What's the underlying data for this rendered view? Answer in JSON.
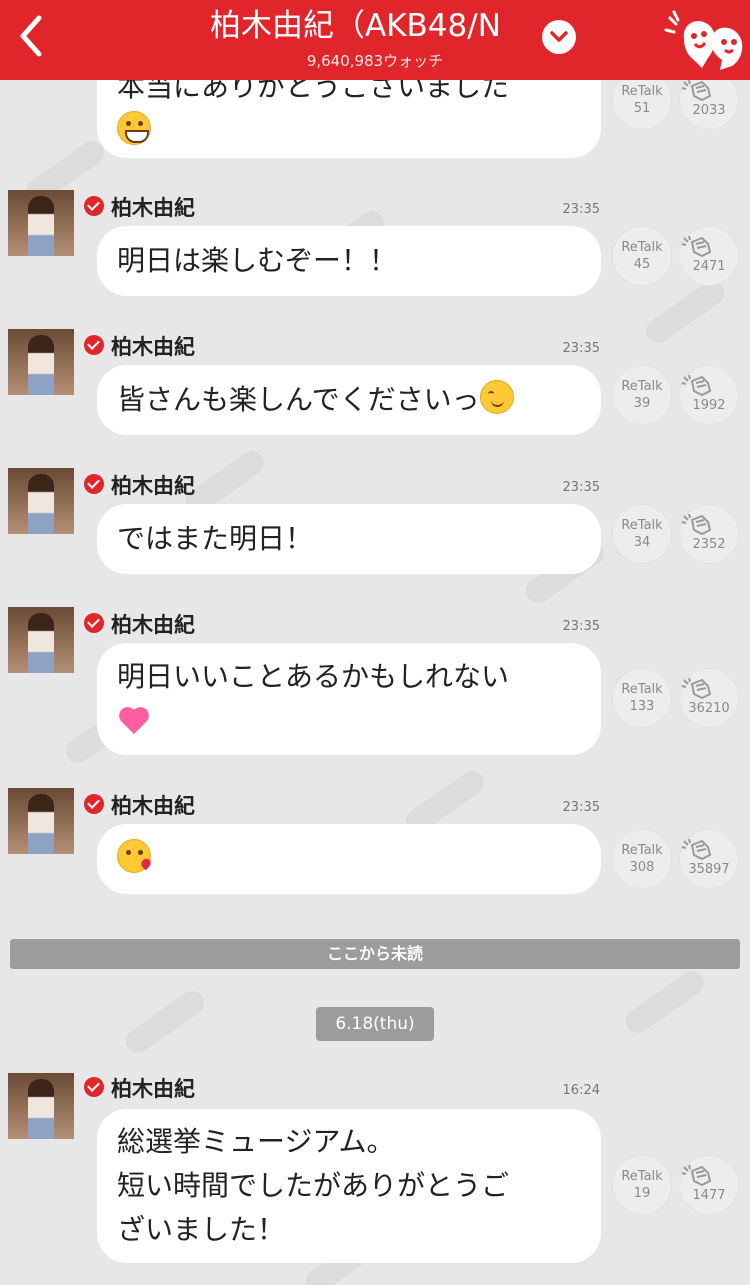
{
  "header": {
    "title": "柏木由紀（AKB48/N",
    "watchers": "9,640,983ウォッチ"
  },
  "colors": {
    "brand_red": "#e0262b",
    "bubble_bg": "#ffffff",
    "page_bg": "#e7e7e7"
  },
  "icons": {
    "back": "chevron-left-icon",
    "dropdown": "chevron-down-icon",
    "mascot": "mascot-icon",
    "verified": "verified-check-icon",
    "clap": "clap-icon"
  },
  "retalk_label": "ReTalk",
  "messages": [
    {
      "id": "m0",
      "partial": true,
      "lines": [
        "本当にありがとうございました"
      ],
      "emoji": "grin",
      "retalk": "51",
      "claps": "2033"
    },
    {
      "id": "m1",
      "author": "柏木由紀",
      "time": "23:35",
      "lines": [
        "明日は楽しむぞー！！"
      ],
      "retalk": "45",
      "claps": "2471"
    },
    {
      "id": "m2",
      "author": "柏木由紀",
      "time": "23:35",
      "lines": [
        "皆さんも楽しんでくださいっ"
      ],
      "emoji": "blush",
      "retalk": "39",
      "claps": "1992"
    },
    {
      "id": "m3",
      "author": "柏木由紀",
      "time": "23:35",
      "lines": [
        "ではまた明日！"
      ],
      "retalk": "34",
      "claps": "2352"
    },
    {
      "id": "m4",
      "author": "柏木由紀",
      "time": "23:35",
      "lines": [
        "明日いいことあるかもしれない"
      ],
      "emoji": "heart",
      "retalk": "133",
      "claps": "36210"
    },
    {
      "id": "m5",
      "author": "柏木由紀",
      "time": "23:35",
      "lines": [],
      "emoji": "kiss",
      "retalk": "308",
      "claps": "35897"
    },
    {
      "id": "m6",
      "author": "柏木由紀",
      "time": "16:24",
      "lines": [
        "総選挙ミュージアム。",
        "短い時間でしたがありがとうご",
        "ざいました！"
      ],
      "retalk": "19",
      "claps": "1477"
    }
  ],
  "unread_divider": "ここから未読",
  "date_separator": "6.18(thu)"
}
